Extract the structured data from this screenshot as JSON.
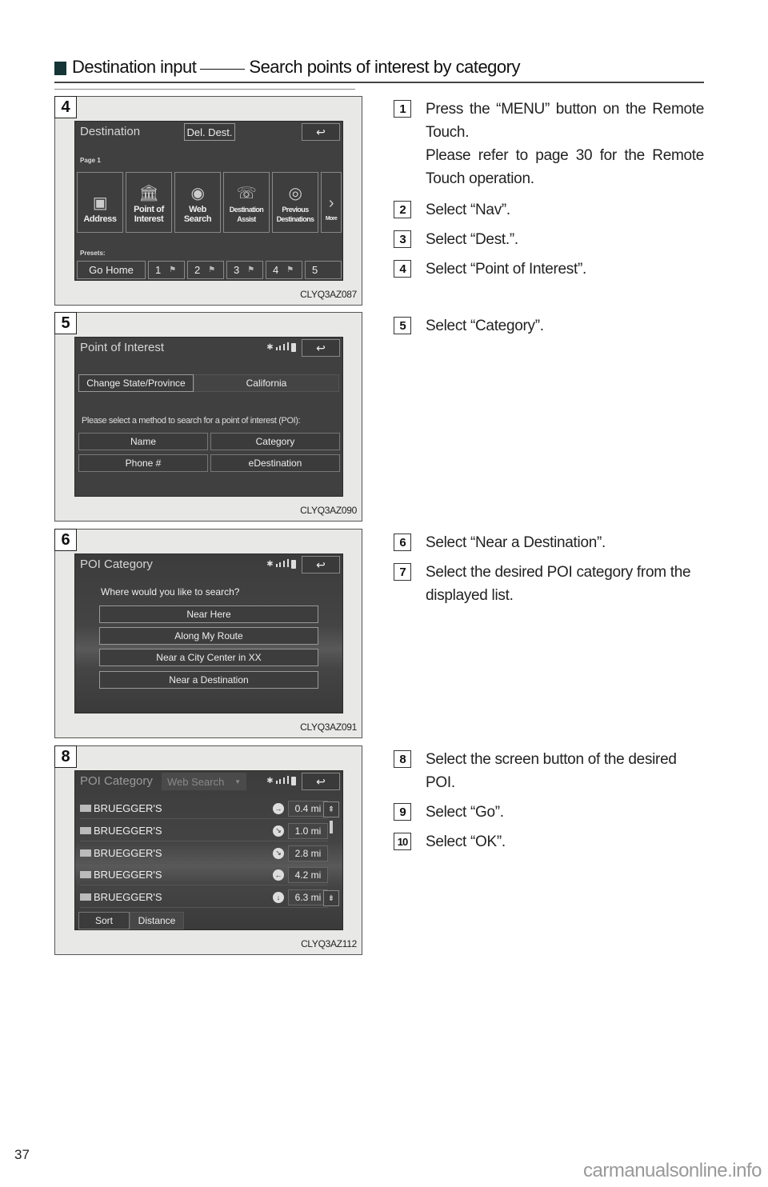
{
  "heading": {
    "part1": "Destination input",
    "part2": "Search points of interest by category"
  },
  "figures": [
    {
      "badge": "4",
      "code": "CLYQ3AZ087",
      "screen": {
        "title": "Destination",
        "del_dest": "Del. Dest.",
        "back": "↩",
        "page_label": "Page 1",
        "tiles": [
          {
            "icon": "address-icon",
            "glyph": "▣",
            "line1": "Address",
            "line2": ""
          },
          {
            "icon": "building-icon",
            "glyph": "🏛",
            "line1": "Point of",
            "line2": "Interest"
          },
          {
            "icon": "globe-icon",
            "glyph": "◉",
            "line1": "Web",
            "line2": "Search"
          },
          {
            "icon": "assist-icon",
            "glyph": "☏",
            "line1": "Destination",
            "line2": "Assist"
          },
          {
            "icon": "previous-icon",
            "glyph": "◎",
            "line1": "Previous",
            "line2": "Destinations"
          },
          {
            "icon": "chevron-right-icon",
            "glyph": "›",
            "line1": "More",
            "line2": ""
          }
        ],
        "presets_label": "Presets:",
        "presets": [
          "Go Home",
          "1",
          "2",
          "3",
          "4",
          "5"
        ]
      }
    },
    {
      "badge": "5",
      "code": "CLYQ3AZ090",
      "screen": {
        "title": "Point of Interest",
        "back": "↩",
        "change_state": "Change State/Province",
        "state_value": "California",
        "prompt": "Please select a method to search for a point of interest (POI):",
        "methods": [
          "Name",
          "Category",
          "Phone #",
          "eDestination"
        ]
      }
    },
    {
      "badge": "6",
      "code": "CLYQ3AZ091",
      "screen": {
        "title": "POI Category",
        "back": "↩",
        "prompt": "Where would you like to search?",
        "options": [
          "Near Here",
          "Along My Route",
          "Near a City Center in XX",
          "Near a Destination"
        ]
      }
    },
    {
      "badge": "8",
      "code": "CLYQ3AZ112",
      "screen": {
        "title": "POI Category",
        "dropdown": "Web Search",
        "back": "↩",
        "rows": [
          {
            "name": "BRUEGGER'S",
            "dir": "→",
            "dist": "0.4 mi"
          },
          {
            "name": "BRUEGGER'S",
            "dir": "↘",
            "dist": "1.0 mi"
          },
          {
            "name": "BRUEGGER'S",
            "dir": "↘",
            "dist": "2.8 mi"
          },
          {
            "name": "BRUEGGER'S",
            "dir": "←",
            "dist": "4.2 mi"
          },
          {
            "name": "BRUEGGER'S",
            "dir": "↓",
            "dist": "6.3 mi"
          }
        ],
        "scroll_up": "⇞",
        "scroll_down": "⇟",
        "sort_label": "Sort",
        "sort_value": "Distance"
      }
    }
  ],
  "steps": [
    {
      "num": "1",
      "text": "Press the “MENU” button on the Remote Touch."
    },
    {
      "num": "",
      "text": "Please refer to page 30 for the Remote Touch operation."
    },
    {
      "num": "2",
      "text": "Select “Nav”."
    },
    {
      "num": "3",
      "text": "Select “Dest.”."
    },
    {
      "num": "4",
      "text": "Select “Point of Interest”."
    },
    {
      "num": "5",
      "text": "Select “Category”."
    },
    {
      "num": "6",
      "text": "Select “Near a Destination”."
    },
    {
      "num": "7",
      "text": "Select the desired POI category from the displayed list."
    },
    {
      "num": "8",
      "text": "Select the screen button of the desired POI."
    },
    {
      "num": "9",
      "text": "Select “Go”."
    },
    {
      "num": "10",
      "text": "Select “OK”."
    }
  ],
  "page_number": "37",
  "watermark": "carmanualsonline.info"
}
